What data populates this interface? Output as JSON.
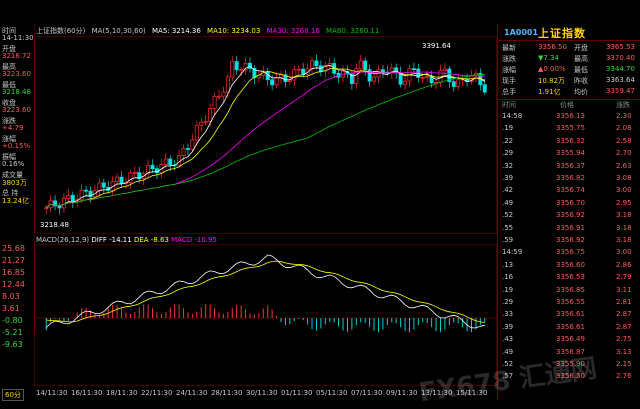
{
  "left_panel": {
    "time_label": "时间",
    "time_value": "14-11:30",
    "open_label": "开盘",
    "open_value": "3216.72",
    "high_label": "最高",
    "high_value": "3223.60",
    "low_label": "最低",
    "low_value": "3218.48",
    "close_label": "收盘",
    "close_value": "3223.60",
    "change_label": "涨跌",
    "change_value": "+4.79",
    "pct_label": "涨幅",
    "pct_value": "+0.15%",
    "amp_label": "振幅",
    "amp_value": "0.16%",
    "vol_label": "成交量",
    "vol_value": "3803万",
    "amt_label": "总 持",
    "amt_value": "13.24亿"
  },
  "top_bar": {
    "title": "上证指数(60分)",
    "ma_params": "MA(5,10,30,60)",
    "ma5": "MA5: 3214.36",
    "ma10": "MA10: 3234.03",
    "ma30": "MA30: 3260.16",
    "ma60": "MA60: 3260.11"
  },
  "price_axis": [
    "3391.64",
    "3218.48"
  ],
  "high_annotation": "3391.64",
  "low_annotation": "3218.48",
  "macd_bar": {
    "label": "MACD(26,12,9)",
    "diff": "DIFF -14.11",
    "dea": "DEA -8.63",
    "macd": "MACD -10.95"
  },
  "macd_axis": [
    "25.68",
    "21.27",
    "16.85",
    "12.44",
    "8.03",
    "3.61",
    "-0.80",
    "-5.21",
    "-9.63"
  ],
  "bottom": {
    "period": "60分",
    "dates": [
      "14/11:30",
      "16/11:30",
      "18/11:30",
      "22/11:30",
      "24/11:30",
      "28/11:30",
      "30/11:30",
      "01/11:30",
      "05/11:30",
      "07/11:30",
      "09/11:30",
      "13/11:30",
      "15/11:30"
    ]
  },
  "quote": {
    "code": "1A0001",
    "name": "上证指数",
    "rows": [
      {
        "l1": "最新",
        "v1": "3356.50",
        "l2": "开盘",
        "v2": "3365.53",
        "c1": "#ff5a5a",
        "c2": "#ff5a5a"
      },
      {
        "l1": "涨跌",
        "v1": "▼7.34",
        "l2": "最高",
        "v2": "3370.40",
        "c1": "#3ad13a",
        "c2": "#ff5a5a"
      },
      {
        "l1": "涨幅",
        "v1": "▲0.00%",
        "l2": "最低",
        "v2": "3344.70",
        "c1": "#ff5a5a",
        "c2": "#3ad13a"
      },
      {
        "l1": "现手",
        "v1": "10.82万",
        "l2": "昨收",
        "v2": "3363.64",
        "c1": "#ffd400",
        "c2": "#c8c8c8"
      },
      {
        "l1": "总手",
        "v1": "1.91亿",
        "l2": "均价",
        "v2": "3359.47",
        "c1": "#ffd400",
        "c2": "#ff5a5a"
      }
    ]
  },
  "trades_header": {
    "time": "时间",
    "price": "价格",
    "chg": "涨跌"
  },
  "trades": [
    {
      "t": "14:58",
      "p": "3356.13",
      "c": "2.30"
    },
    {
      "t": ".19",
      "p": "3355.75",
      "c": "2.08"
    },
    {
      "t": ".22",
      "p": "3356.32",
      "c": "2.58"
    },
    {
      "t": ".29",
      "p": "3355.94",
      "c": "2.70"
    },
    {
      "t": ".32",
      "p": "3356.37",
      "c": "2.63"
    },
    {
      "t": ".39",
      "p": "3356.82",
      "c": "3.08"
    },
    {
      "t": ".42",
      "p": "3356.74",
      "c": "3.00"
    },
    {
      "t": ".49",
      "p": "3356.70",
      "c": "2.95"
    },
    {
      "t": ".52",
      "p": "3356.92",
      "c": "3.18"
    },
    {
      "t": ".55",
      "p": "3356.91",
      "c": "3.18"
    },
    {
      "t": ".59",
      "p": "3356.92",
      "c": "3.18"
    },
    {
      "t": "14:59",
      "p": "3356.75",
      "c": "3.00"
    },
    {
      "t": ".13",
      "p": "3356.60",
      "c": "2.86"
    },
    {
      "t": ".16",
      "p": "3356.53",
      "c": "2.79"
    },
    {
      "t": ".19",
      "p": "3356.85",
      "c": "3.11"
    },
    {
      "t": ".29",
      "p": "3356.55",
      "c": "2.81"
    },
    {
      "t": ".33",
      "p": "3356.61",
      "c": "2.87"
    },
    {
      "t": ".39",
      "p": "3356.61",
      "c": "2.87"
    },
    {
      "t": ".43",
      "p": "3356.49",
      "c": "2.75"
    },
    {
      "t": ".49",
      "p": "3356.87",
      "c": "3.13"
    },
    {
      "t": ".52",
      "p": "3355.90",
      "c": "2.15"
    },
    {
      "t": ".57",
      "p": "3356.50",
      "c": "2.76"
    }
  ],
  "watermark": "FX678 汇通网",
  "colors": {
    "up": "#ff3030",
    "down": "#00e0e0",
    "ma5": "#ffffff",
    "ma10": "#ffff00",
    "ma30": "#ff00ff",
    "ma60": "#00c000",
    "frame": "#800000"
  }
}
